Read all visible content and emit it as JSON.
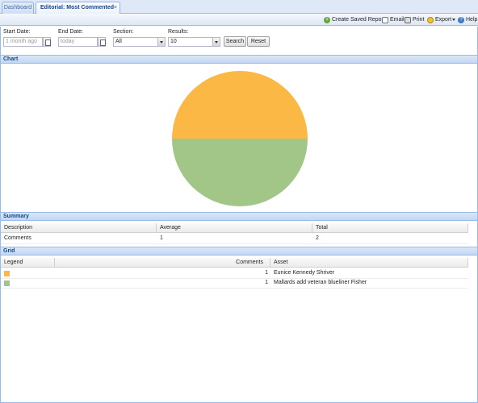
{
  "tabs": [
    {
      "label": "Dashboard",
      "active": false
    },
    {
      "label": "Editorial: Most Commented",
      "active": true,
      "close": "×"
    }
  ],
  "toolbar": {
    "create_saved_report": "Create Saved Report",
    "email": "Email",
    "print": "Print",
    "export": "Export",
    "help": "Help"
  },
  "filters": {
    "start_date_label": "Start Date:",
    "start_date_placeholder": "1 month ago",
    "end_date_label": "End Date:",
    "end_date_placeholder": "today",
    "section_label": "Section:",
    "section_value": "All",
    "results_label": "Results:",
    "results_value": "10",
    "search_button": "Search",
    "reset_button": "Reset"
  },
  "panels": {
    "chart": "Chart",
    "summary": "Summary",
    "grid": "Grid"
  },
  "chart_data": {
    "type": "pie",
    "slices": [
      {
        "label": "Eunice Kennedy Shriver",
        "value": 1,
        "color": "#fbb845"
      },
      {
        "label": "Mallards add veteran blueliner Fisher",
        "value": 1,
        "color": "#a2c588"
      }
    ]
  },
  "summary": {
    "headers": {
      "description": "Description",
      "average": "Average",
      "total": "Total"
    },
    "rows": [
      {
        "description": "Comments",
        "average": "1",
        "total": "2"
      }
    ]
  },
  "grid": {
    "headers": {
      "legend": "Legend",
      "comments": "Comments",
      "asset": "Asset"
    },
    "rows": [
      {
        "color": "#fbb845",
        "comments": "1",
        "asset": "Eunice Kennedy Shriver"
      },
      {
        "color": "#a2c588",
        "comments": "1",
        "asset": "Mallards add veteran blueliner Fisher"
      }
    ]
  }
}
